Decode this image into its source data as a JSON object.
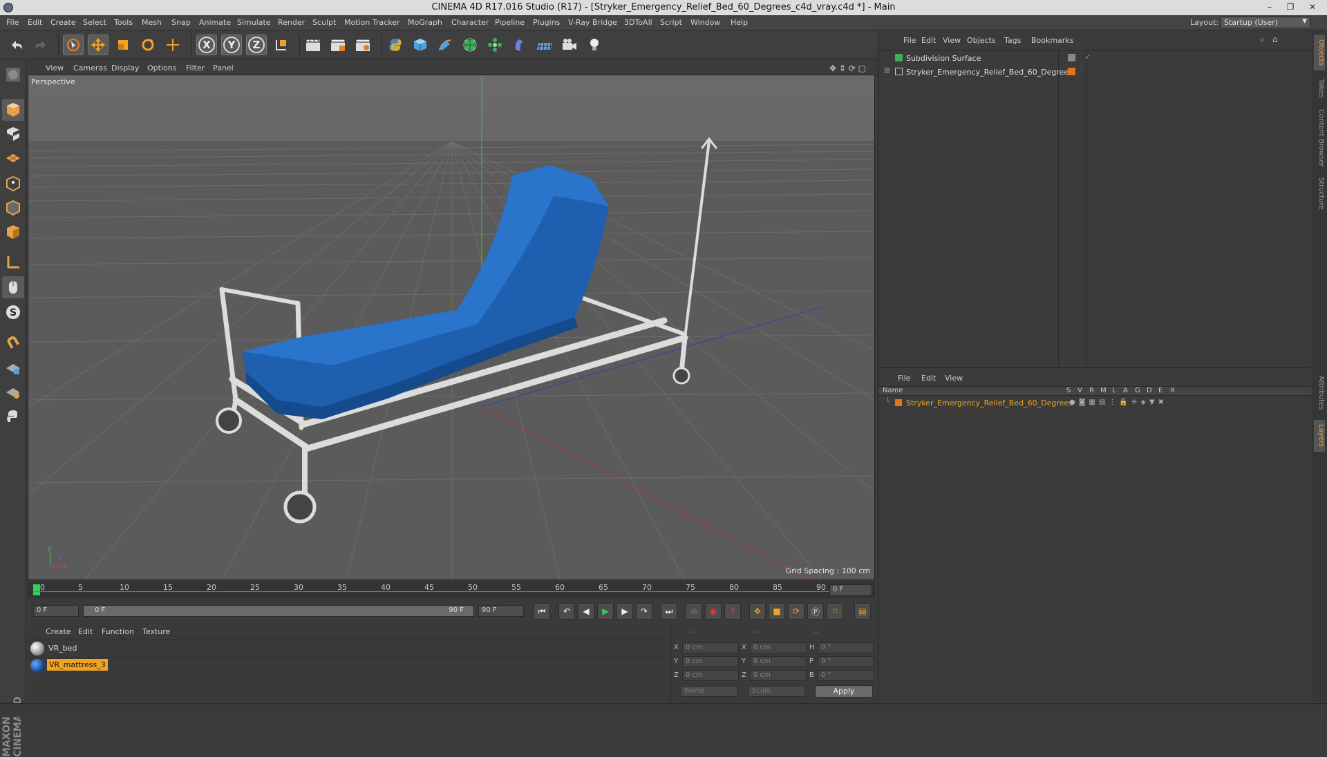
{
  "window": {
    "title": "CINEMA 4D R17.016 Studio (R17) - [Stryker_Emergency_Relief_Bed_60_Degrees_c4d_vray.c4d *] - Main",
    "minimize": "–",
    "restore": "❐",
    "close": "✕"
  },
  "menu": [
    "File",
    "Edit",
    "Create",
    "Select",
    "Tools",
    "Mesh",
    "Snap",
    "Animate",
    "Simulate",
    "Render",
    "Sculpt",
    "Motion Tracker",
    "MoGraph",
    "Character",
    "Pipeline",
    "Plugins",
    "V-Ray Bridge",
    "3DToAll",
    "Script",
    "Window",
    "Help"
  ],
  "layout": {
    "label": "Layout:",
    "value": "Startup (User)"
  },
  "toolbar": {
    "x_axis": "X",
    "y_axis": "Y",
    "z_axis": "Z"
  },
  "viewport": {
    "menu": [
      "View",
      "Cameras",
      "Display",
      "Options",
      "Filter",
      "Panel"
    ],
    "label": "Perspective",
    "grid_spacing": "Grid Spacing : 100 cm"
  },
  "timeline": {
    "ticks": [
      "0",
      "5",
      "10",
      "15",
      "20",
      "25",
      "30",
      "35",
      "40",
      "45",
      "50",
      "55",
      "60",
      "65",
      "70",
      "75",
      "80",
      "85",
      "90"
    ],
    "current_frame": "0 F",
    "start_field": "0 F",
    "range_start": "0 F",
    "range_end": "90 F",
    "end_field": "90 F"
  },
  "materials": {
    "menu": [
      "Create",
      "Edit",
      "Function",
      "Texture"
    ],
    "items": [
      {
        "name": "VR_bed",
        "selected": false,
        "color": "#c8c8c8"
      },
      {
        "name": "VR_mattress_3",
        "selected": true,
        "color": "#1b5fb5"
      }
    ]
  },
  "coordinates": {
    "headers": [
      "--",
      "--",
      "--"
    ],
    "rows": [
      {
        "a": "X",
        "av": "0 cm",
        "b": "X",
        "bv": "0 cm",
        "c": "H",
        "cv": "0 °"
      },
      {
        "a": "Y",
        "av": "0 cm",
        "b": "Y",
        "bv": "0 cm",
        "c": "P",
        "cv": "0 °"
      },
      {
        "a": "Z",
        "av": "0 cm",
        "b": "Z",
        "bv": "0 cm",
        "c": "B",
        "cv": "0 °"
      }
    ],
    "world": "World",
    "scale": "Scale",
    "apply": "Apply"
  },
  "objects": {
    "menu": [
      "File",
      "Edit",
      "View",
      "Objects",
      "Tags",
      "Bookmarks"
    ],
    "items": [
      {
        "name": "Subdivision Surface"
      },
      {
        "name": "Stryker_Emergency_Relief_Bed_60_Degrees"
      }
    ]
  },
  "layers": {
    "menu": [
      "File",
      "Edit",
      "View"
    ],
    "columns": [
      "Name",
      "S",
      "V",
      "R",
      "M",
      "L",
      "A",
      "G",
      "D",
      "E",
      "X"
    ],
    "items": [
      {
        "name": "Stryker_Emergency_Relief_Bed_60_Degrees",
        "color": "#e2741c"
      }
    ]
  },
  "right_tabs": [
    "Objects",
    "Takes",
    "Content Browser",
    "Structure",
    "Attributes",
    "Layers"
  ],
  "brand": "MAXON CINEMA 4D"
}
